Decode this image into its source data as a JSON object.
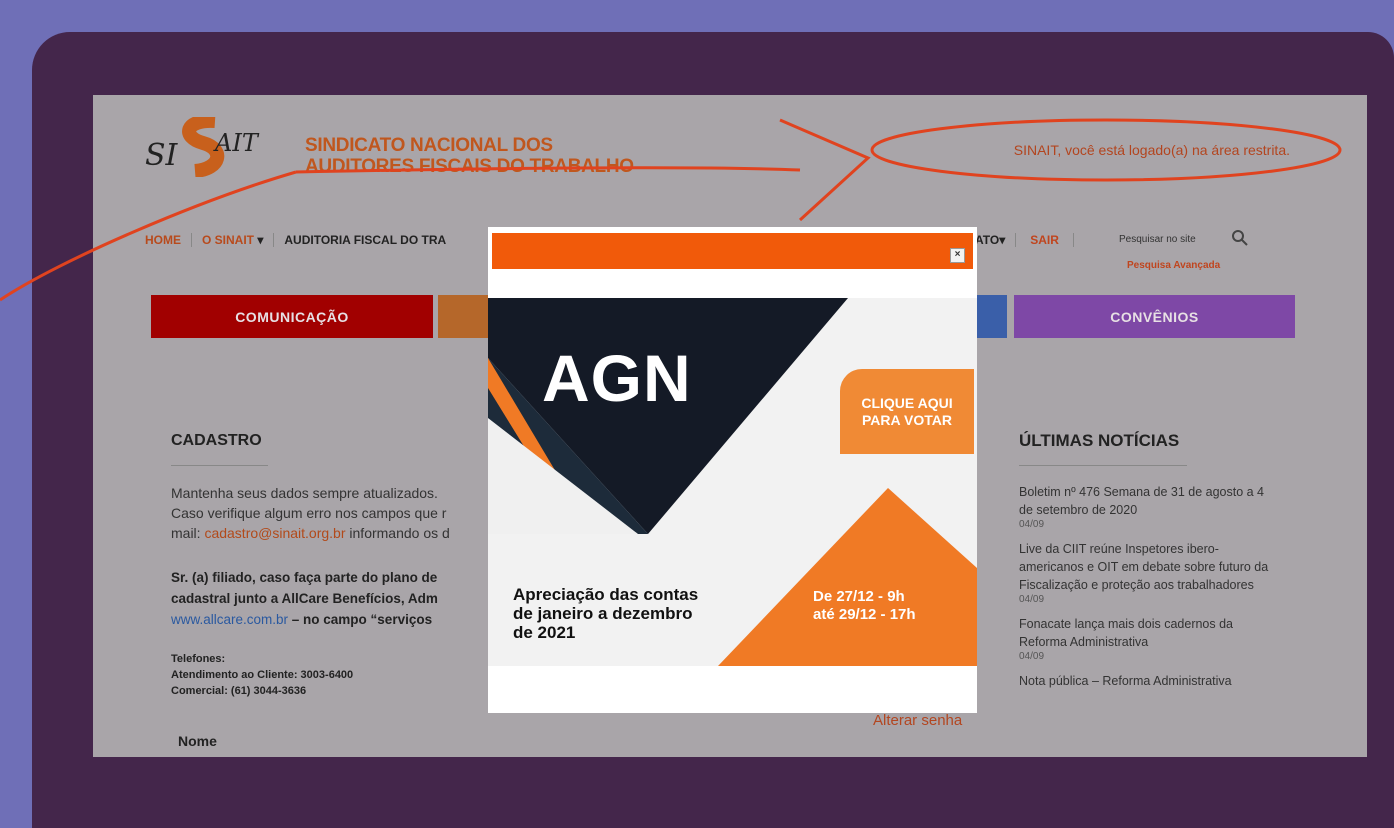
{
  "header": {
    "logo_text": "SINAIT",
    "org_name_line1": "SINDICATO NACIONAL DOS",
    "org_name_line2": "AUDITORES FISCAIS DO TRABALHO",
    "logged_message": "SINAIT, você está logado(a) na área restrita."
  },
  "nav": {
    "items": [
      "HOME",
      "O SINAIT",
      "AUDITORIA FISCAL DO TRA"
    ],
    "right_item": "ATO",
    "logout": "SAIR",
    "search_placeholder": "Pesquisar no site",
    "advanced_search": "Pesquisa Avançada"
  },
  "tabs": {
    "comunicacao": "COMUNICAÇÃO",
    "convenios": "CONVÊNIOS"
  },
  "cadastro": {
    "heading": "CADASTRO",
    "line1": "Mantenha seus dados sempre atualizados.",
    "line2": "Caso verifique algum erro nos campos que r",
    "line3_prefix": "mail: ",
    "email": "cadastro@sinait.org.br",
    "line3_suffix": " informando os d",
    "bold1": "Sr. (a) filiado, caso faça parte do plano de",
    "bold2": "cadastral junto a AllCare Benefícios, Adm",
    "bold3_link": "www.allcare.com.br",
    "bold3_suffix": " – no campo “serviços",
    "phones_label": "Telefones:",
    "phone1": "Atendimento ao Cliente: 3003-6400",
    "phone2": "Comercial: (61) 3044-3636",
    "nome_label": "Nome",
    "change_password": "Alterar senha"
  },
  "news": {
    "heading": "ÚLTIMAS NOTÍCIAS",
    "items": [
      {
        "title": "Boletim nº 476 Semana de 31 de agosto a 4 de setembro de 2020",
        "date": "04/09"
      },
      {
        "title": "Live da CIIT reúne Inspetores ibero-americanos e OIT em debate sobre futuro da Fiscalização e proteção aos trabalhadores",
        "date": "04/09"
      },
      {
        "title": "Fonacate lança mais dois cadernos da Reforma Administrativa",
        "date": "04/09"
      },
      {
        "title": "Nota pública – Reforma Administrativa",
        "date": ""
      }
    ]
  },
  "modal": {
    "close": "×",
    "agn": "AGN",
    "cta_line1": "CLIQUE AQUI",
    "cta_line2": "PARA VOTAR",
    "desc_line1": "Apreciação das contas",
    "desc_line2": "de janeiro a dezembro",
    "desc_line3": "de 2021",
    "date_line1": "De 27/12 - 9h",
    "date_line2": "até 29/12 - 17h"
  }
}
